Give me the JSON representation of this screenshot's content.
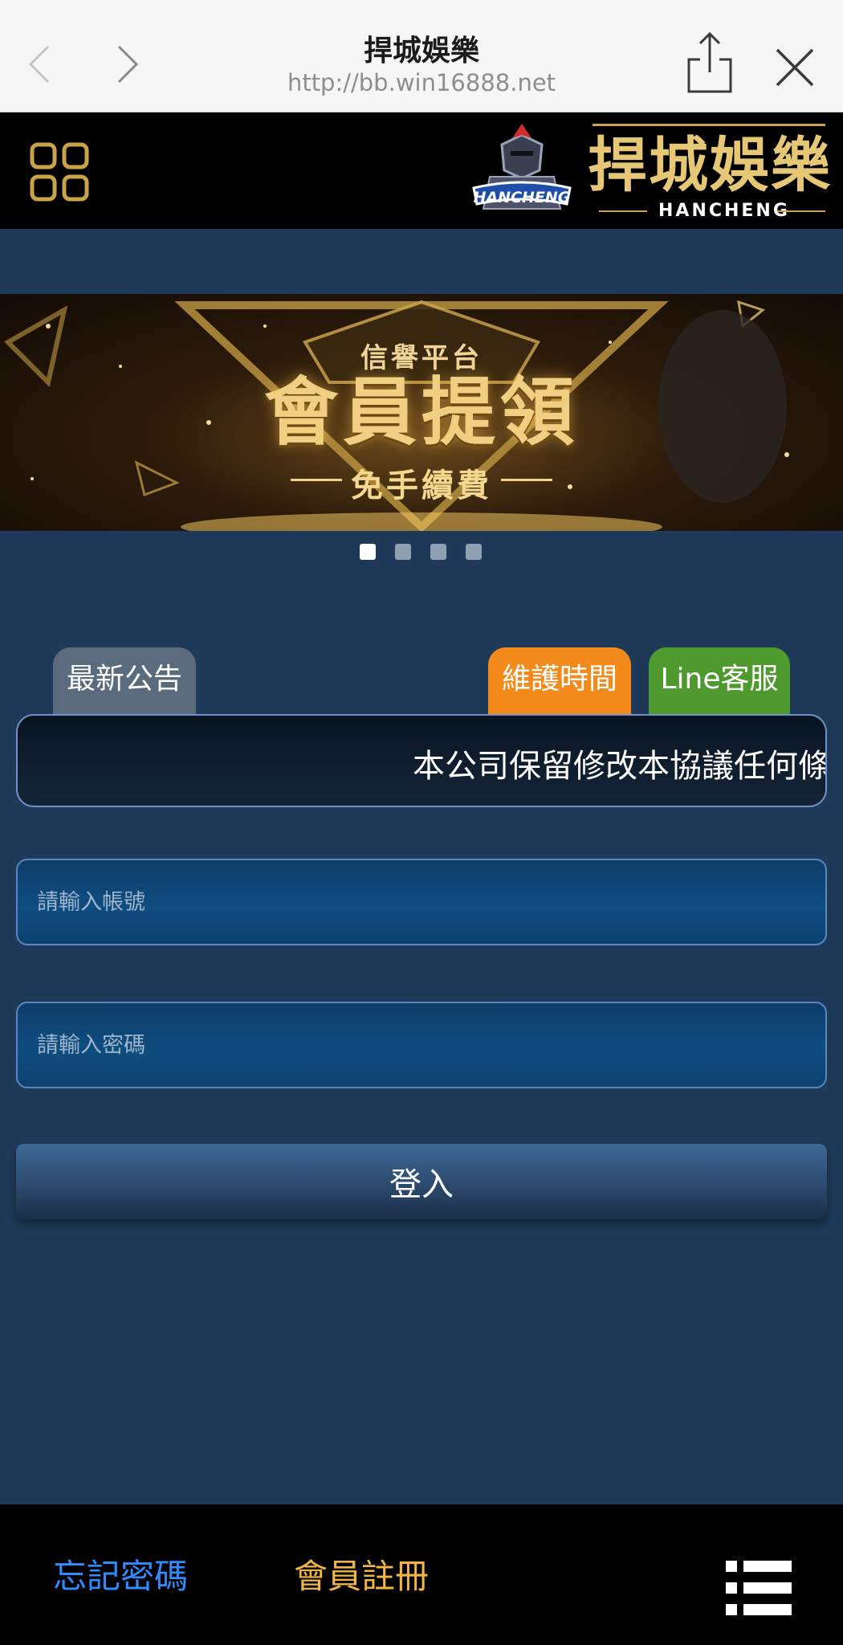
{
  "browser": {
    "title": "捍城娛樂",
    "url": "http://bb.win16888.net",
    "icons": [
      "chevron-left-icon",
      "chevron-right-icon",
      "share-icon",
      "close-icon"
    ]
  },
  "header": {
    "logo_cn": "捍城娛樂",
    "logo_en": "HANCHENG",
    "logo_badge": "HANCHENG",
    "menu_icon": "grid-icon"
  },
  "banner": {
    "small": "信譽平台",
    "main": "會員提領",
    "sub": "免手續費",
    "slide_count": 4,
    "active_slide": 1
  },
  "tabs": {
    "notice": "最新公告",
    "maintenance": "維護時間",
    "line": "Line客服"
  },
  "marquee": {
    "text": "本公司保留修改本協議任何條款"
  },
  "form": {
    "account_placeholder": "請輸入帳號",
    "password_placeholder": "請輸入密碼",
    "login_label": "登入"
  },
  "footer": {
    "forgot": "忘記密碼",
    "register": "會員註冊",
    "menu_icon": "list-menu-icon"
  },
  "colors": {
    "page_bg": "#1e3a58",
    "tab_notice": "#5b6b7e",
    "tab_maintenance": "#f28a1c",
    "tab_line": "#4e9a2e",
    "forgot_link": "#2f8cff",
    "register_link": "#f0b447",
    "gold": "#e6c775"
  }
}
